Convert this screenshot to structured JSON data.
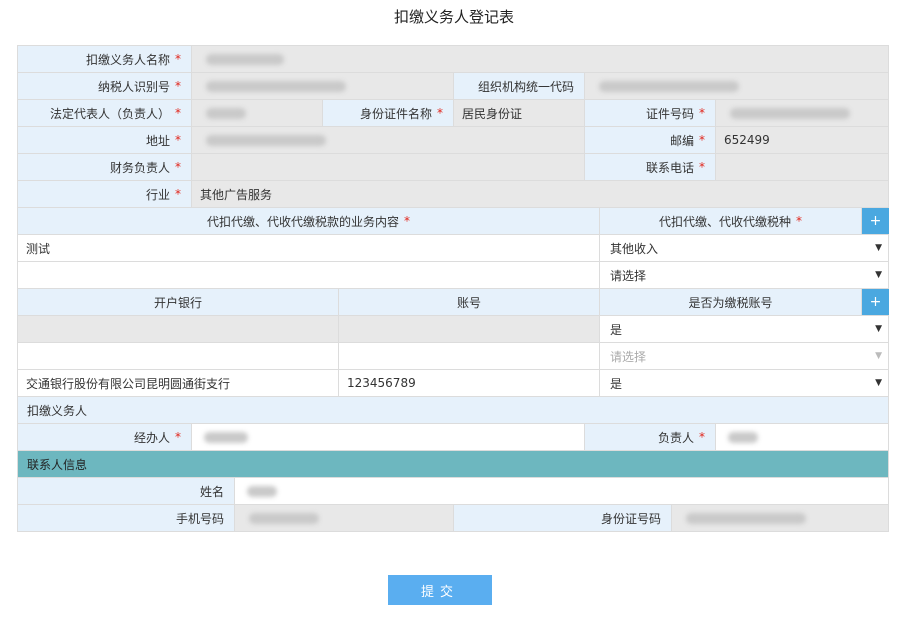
{
  "title": "扣缴义务人登记表",
  "labels": {
    "agent_name": "扣缴义务人名称",
    "taxpayer_id": "纳税人识别号",
    "org_code": "组织机构统一代码",
    "legal_rep": "法定代表人（负责人）",
    "id_doc_name": "身份证件名称",
    "doc_number": "证件号码",
    "address": "地址",
    "postcode": "邮编",
    "finance_person": "财务负责人",
    "phone": "联系电话",
    "industry": "行业",
    "biz_content": "代扣代缴、代收代缴税款的业务内容",
    "tax_type": "代扣代缴、代收代缴税种",
    "bank": "开户银行",
    "account": "账号",
    "is_tax_account": "是否为缴税账号",
    "withholding_agent": "扣缴义务人",
    "handler": "经办人",
    "person_in_charge": "负责人",
    "contact_info": "联系人信息",
    "name": "姓名",
    "mobile": "手机号码",
    "id_number": "身份证号码"
  },
  "required_mark": "*",
  "values": {
    "id_doc_name": "居民身份证",
    "postcode": "652499",
    "industry": "其他广告服务"
  },
  "biz_rows": [
    {
      "content": "测试",
      "tax_type": "其他收入"
    },
    {
      "content": "",
      "tax_type": "请选择"
    }
  ],
  "bank_rows": [
    {
      "bank": "",
      "account": "",
      "is_tax": "是"
    },
    {
      "bank": "",
      "account": "",
      "is_tax": "请选择"
    },
    {
      "bank": "交通银行股份有限公司昆明圆通街支行",
      "account": "123456789",
      "is_tax": "是"
    }
  ],
  "plus_label": "+",
  "submit_label": "提交",
  "icons": {
    "dropdown": "caret-down-icon",
    "add": "plus-icon"
  },
  "colors": {
    "label_bg": "#e6f1fb",
    "readonly_bg": "#e8e8e8",
    "section_teal": "#6db7bf",
    "button_blue": "#5aaef0",
    "required": "#e1251b"
  }
}
